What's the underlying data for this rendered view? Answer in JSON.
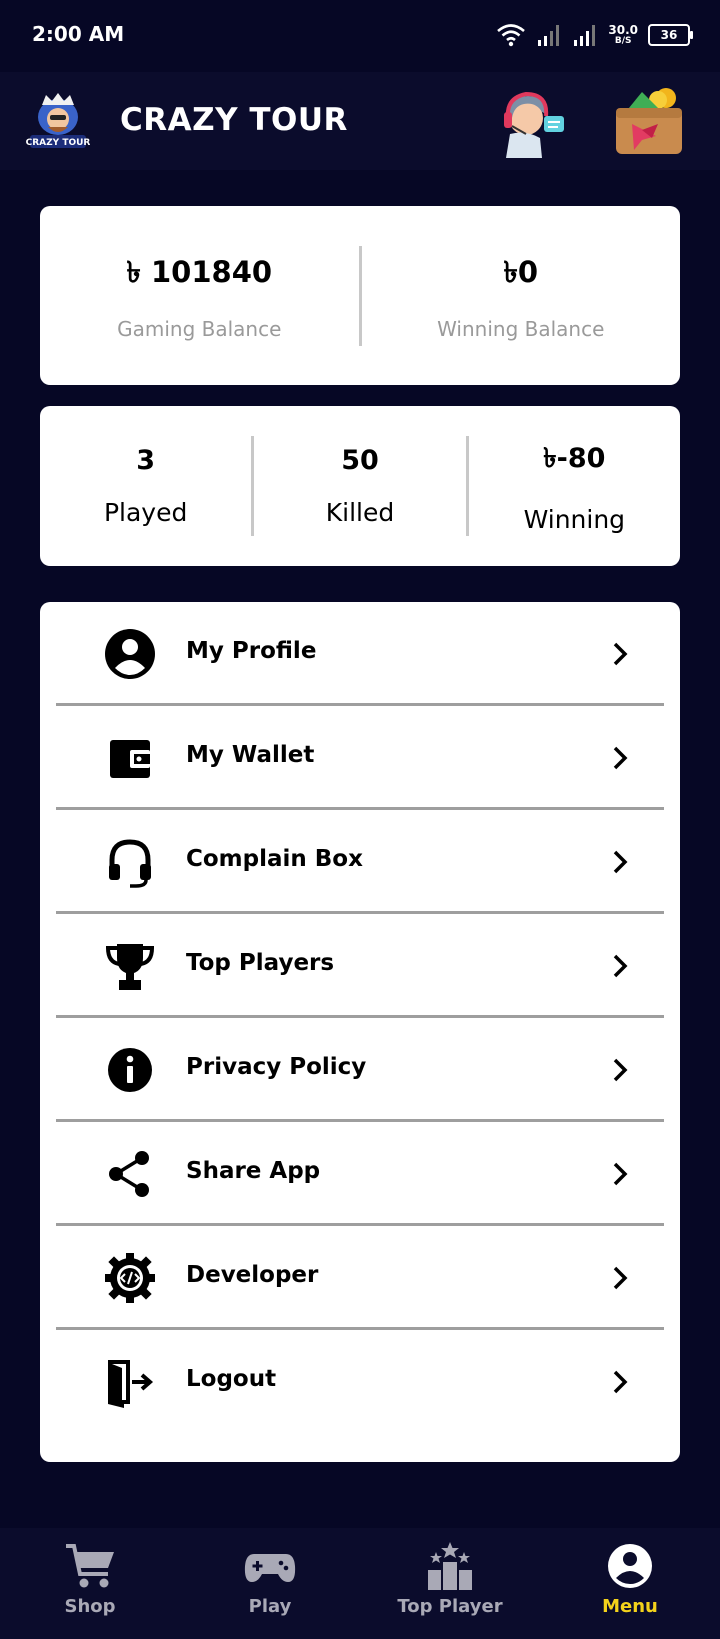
{
  "status_bar": {
    "time": "2:00 AM",
    "net_speed_value": "30.0",
    "net_speed_unit": "B/S",
    "battery": "36"
  },
  "app_bar": {
    "logo_text": "CRAZY TOUR",
    "title": "CRAZY TOUR",
    "support_icon": "support-agent-icon",
    "wallet_icon": "wallet-icon"
  },
  "balances": {
    "gaming": {
      "amount": "৳ 101840",
      "label": "Gaming Balance"
    },
    "winning": {
      "amount": "৳0",
      "label": "Winning Balance"
    }
  },
  "stats": [
    {
      "value": "3",
      "label": "Played"
    },
    {
      "value": "50",
      "label": "Killed"
    },
    {
      "value": "৳-80",
      "label": "Winning"
    }
  ],
  "menu": [
    {
      "label": "My Profile",
      "icon": "user-circle-icon"
    },
    {
      "label": "My Wallet",
      "icon": "wallet-icon"
    },
    {
      "label": "Complain Box",
      "icon": "headset-icon"
    },
    {
      "label": "Top Players",
      "icon": "trophy-icon"
    },
    {
      "label": "Privacy Policy",
      "icon": "info-icon"
    },
    {
      "label": "Share App",
      "icon": "share-icon"
    },
    {
      "label": "Developer",
      "icon": "developer-gear-icon"
    },
    {
      "label": "Logout",
      "icon": "logout-icon"
    }
  ],
  "bottom_nav": [
    {
      "label": "Shop",
      "icon": "cart-icon",
      "active": false
    },
    {
      "label": "Play",
      "icon": "gamepad-icon",
      "active": false
    },
    {
      "label": "Top Player",
      "icon": "podium-icon",
      "active": false
    },
    {
      "label": "Menu",
      "icon": "user-circle-icon",
      "active": true
    }
  ],
  "colors": {
    "background": "#060725",
    "bar": "#0b0c2c",
    "active_nav": "#f3d21b",
    "inactive_nav": "#a9a9b6"
  }
}
